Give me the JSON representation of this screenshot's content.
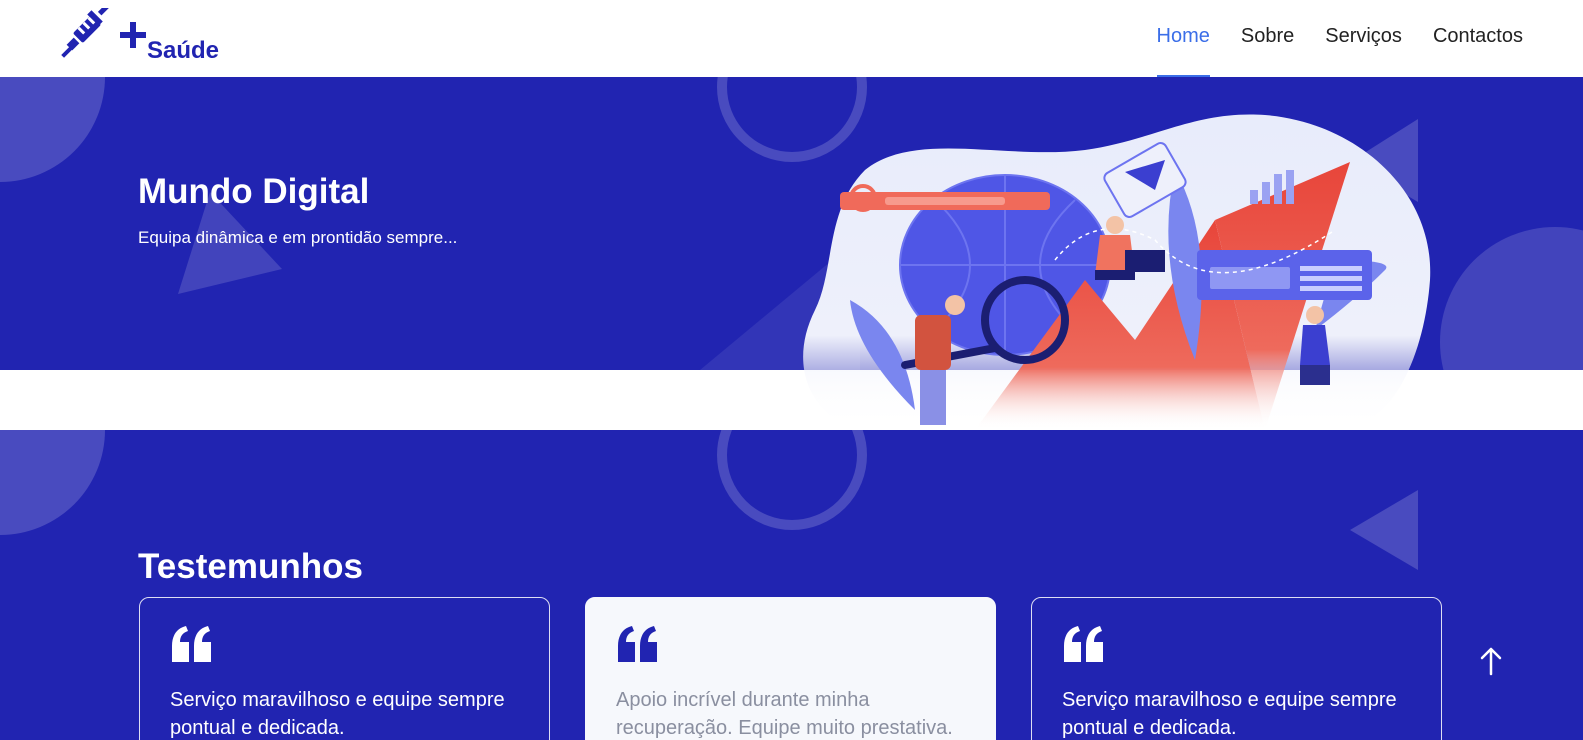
{
  "header": {
    "logo": {
      "text": "Saúde"
    },
    "nav": [
      {
        "label": "Home",
        "active": true
      },
      {
        "label": "Sobre",
        "active": false
      },
      {
        "label": "Serviços",
        "active": false
      },
      {
        "label": "Contactos",
        "active": false
      }
    ]
  },
  "hero": {
    "title": "Mundo Digital",
    "subtitle": "Equipa dinâmica e em prontidão sempre..."
  },
  "testimonials": {
    "title": "Testemunhos",
    "cards": [
      {
        "text": "Serviço maravilhoso e equipe sempre pontual e dedicada.",
        "style": "outline"
      },
      {
        "text": "Apoio incrível durante minha recuperação. Equipe muito prestativa.",
        "style": "light"
      },
      {
        "text": "Serviço maravilhoso e equipe sempre pontual e dedicada.",
        "style": "outline"
      }
    ]
  },
  "icons": {
    "logo": "syringe-icon",
    "quote": "quote-icon",
    "scroll_top": "arrow-up-icon"
  },
  "colors": {
    "brand_blue": "#2124b1",
    "nav_active": "#3b6ee8",
    "card_light": "#f6f8fc"
  }
}
